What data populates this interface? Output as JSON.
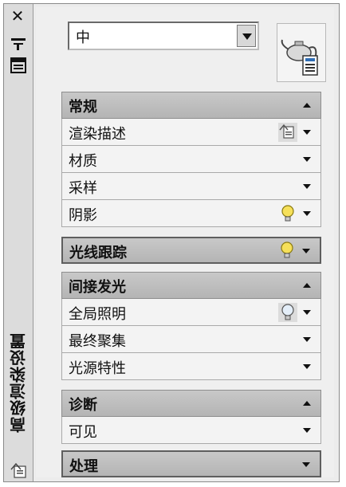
{
  "palette": {
    "title": "高级渲染设置",
    "close_label": "✕"
  },
  "preset": {
    "selected": "中"
  },
  "sections": [
    {
      "title": "常规",
      "rows": [
        "渲染描述",
        "材质",
        "采样",
        "阴影"
      ]
    },
    {
      "title": "光线跟踪",
      "rows": []
    },
    {
      "title": "间接发光",
      "rows": [
        "全局照明",
        "最终聚集",
        "光源特性"
      ]
    },
    {
      "title": "诊断",
      "rows": [
        "可见"
      ]
    },
    {
      "title": "处理",
      "rows": []
    }
  ],
  "icons": {
    "close": "close-icon",
    "autohide": "auto-hide-icon",
    "properties": "properties-icon",
    "render": "teapot-render-icon",
    "bulb": "light-bulb-icon",
    "render_description": "render-description-icon"
  }
}
